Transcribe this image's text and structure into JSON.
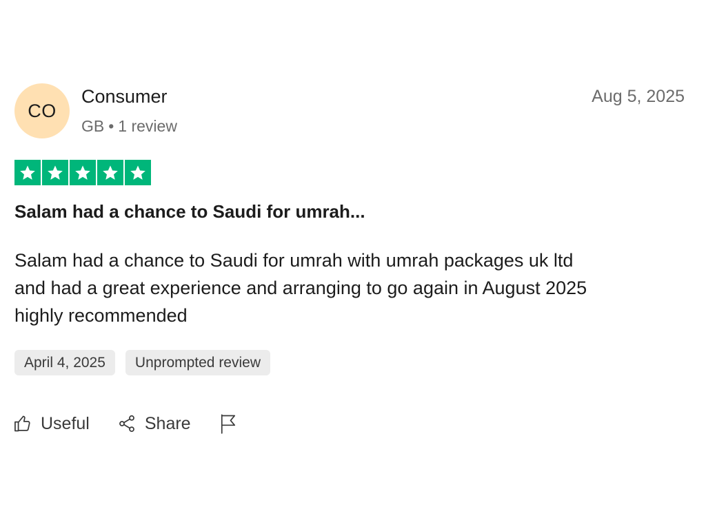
{
  "consumer": {
    "initials": "CO",
    "name": "Consumer",
    "country": "GB",
    "separator": "•",
    "review_count": "1 review"
  },
  "review": {
    "date": "Aug 5, 2025",
    "rating": 5,
    "rating_max": 5,
    "star_color": "#00b67a",
    "title": "Salam had a chance to Saudi for umrah...",
    "body_lines": [
      "Salam had a chance to Saudi for umrah with umrah packages uk ltd",
      "and had a great experience and arranging to go again in August 2025",
      "highly recommended"
    ],
    "experience_date": "April 4, 2025",
    "review_type": "Unprompted review"
  },
  "actions": {
    "useful_label": "Useful",
    "useful_icon": "thumbs-up-icon",
    "share_label": "Share",
    "share_icon": "share-icon",
    "flag_icon": "flag-icon"
  },
  "colors": {
    "avatar_bg": "#ffe0b2",
    "tag_bg": "#ececec"
  }
}
